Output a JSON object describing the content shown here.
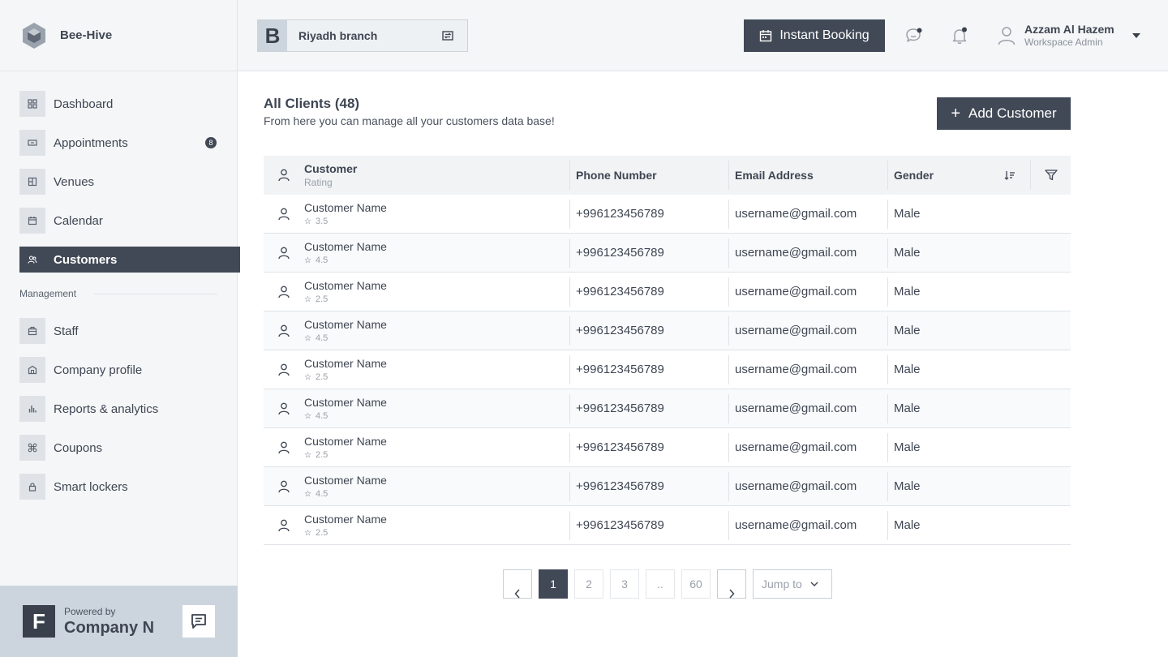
{
  "brand": {
    "name": "Bee-Hive"
  },
  "sidebar": {
    "items": [
      {
        "label": "Dashboard",
        "icon": "grid-icon"
      },
      {
        "label": "Appointments",
        "icon": "ticket-icon",
        "badge": "8"
      },
      {
        "label": "Venues",
        "icon": "venue-icon"
      },
      {
        "label": "Calendar",
        "icon": "calendar-icon"
      },
      {
        "label": "Customers",
        "icon": "users-icon",
        "active": true
      }
    ],
    "section_title": "Management",
    "management_items": [
      {
        "label": "Staff",
        "icon": "briefcase-icon"
      },
      {
        "label": "Company profile",
        "icon": "building-icon"
      },
      {
        "label": "Reports & analytics",
        "icon": "bar-chart-icon"
      },
      {
        "label": "Coupons",
        "icon": "coupon-icon"
      },
      {
        "label": "Smart lockers",
        "icon": "lock-icon"
      }
    ],
    "footer": {
      "logo_letter": "F",
      "powered_by": "Powered by",
      "company": "Company N"
    }
  },
  "topbar": {
    "branch_logo_letter": "B",
    "branch_name": "Riyadh branch",
    "instant_booking": "Instant Booking",
    "user_name": "Azzam Al Hazem",
    "user_role": "Workspace Admin"
  },
  "main": {
    "title": "All Clients (48)",
    "subtitle": "From here you can manage all your customers data base!",
    "add_button": "Add Customer",
    "add_plus": "+",
    "columns": {
      "customer": "Customer",
      "rating": "Rating",
      "phone": "Phone Number",
      "email": "Email Address",
      "gender": "Gender"
    },
    "rows": [
      {
        "name": "Customer Name",
        "rating": "3.5",
        "phone": "+996123456789",
        "email": "username@gmail.com",
        "gender": "Male"
      },
      {
        "name": "Customer Name",
        "rating": "4.5",
        "phone": "+996123456789",
        "email": "username@gmail.com",
        "gender": "Male"
      },
      {
        "name": "Customer Name",
        "rating": "2.5",
        "phone": "+996123456789",
        "email": "username@gmail.com",
        "gender": "Male"
      },
      {
        "name": "Customer Name",
        "rating": "4.5",
        "phone": "+996123456789",
        "email": "username@gmail.com",
        "gender": "Male"
      },
      {
        "name": "Customer Name",
        "rating": "2.5",
        "phone": "+996123456789",
        "email": "username@gmail.com",
        "gender": "Male"
      },
      {
        "name": "Customer Name",
        "rating": "4.5",
        "phone": "+996123456789",
        "email": "username@gmail.com",
        "gender": "Male"
      },
      {
        "name": "Customer Name",
        "rating": "2.5",
        "phone": "+996123456789",
        "email": "username@gmail.com",
        "gender": "Male"
      },
      {
        "name": "Customer Name",
        "rating": "4.5",
        "phone": "+996123456789",
        "email": "username@gmail.com",
        "gender": "Male"
      },
      {
        "name": "Customer Name",
        "rating": "2.5",
        "phone": "+996123456789",
        "email": "username@gmail.com",
        "gender": "Male"
      }
    ],
    "pagination": {
      "pages": [
        "1",
        "2",
        "3",
        "..",
        "60"
      ],
      "current": "1",
      "jump_to": "Jump to"
    }
  },
  "colors": {
    "accent": "#414956",
    "sidebar_bg": "#f4f6f7",
    "footer_bg": "#ccd5de"
  }
}
